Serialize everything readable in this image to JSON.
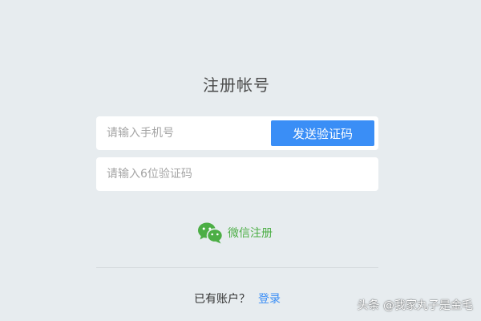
{
  "page_title": "注册帐号",
  "phone_field": {
    "placeholder": "请输入手机号",
    "value": ""
  },
  "send_code_button": "发送验证码",
  "code_field": {
    "placeholder": "请输入6位验证码",
    "value": ""
  },
  "wechat_register": {
    "icon": "wechat-icon",
    "label": "微信注册"
  },
  "login_prompt": {
    "text": "已有账户？",
    "link_label": "登录"
  },
  "watermark": "头条 @我家丸子是金毛",
  "colors": {
    "background": "#e7ecef",
    "primary": "#3a8ef6",
    "wechat_green": "#4cae45"
  }
}
